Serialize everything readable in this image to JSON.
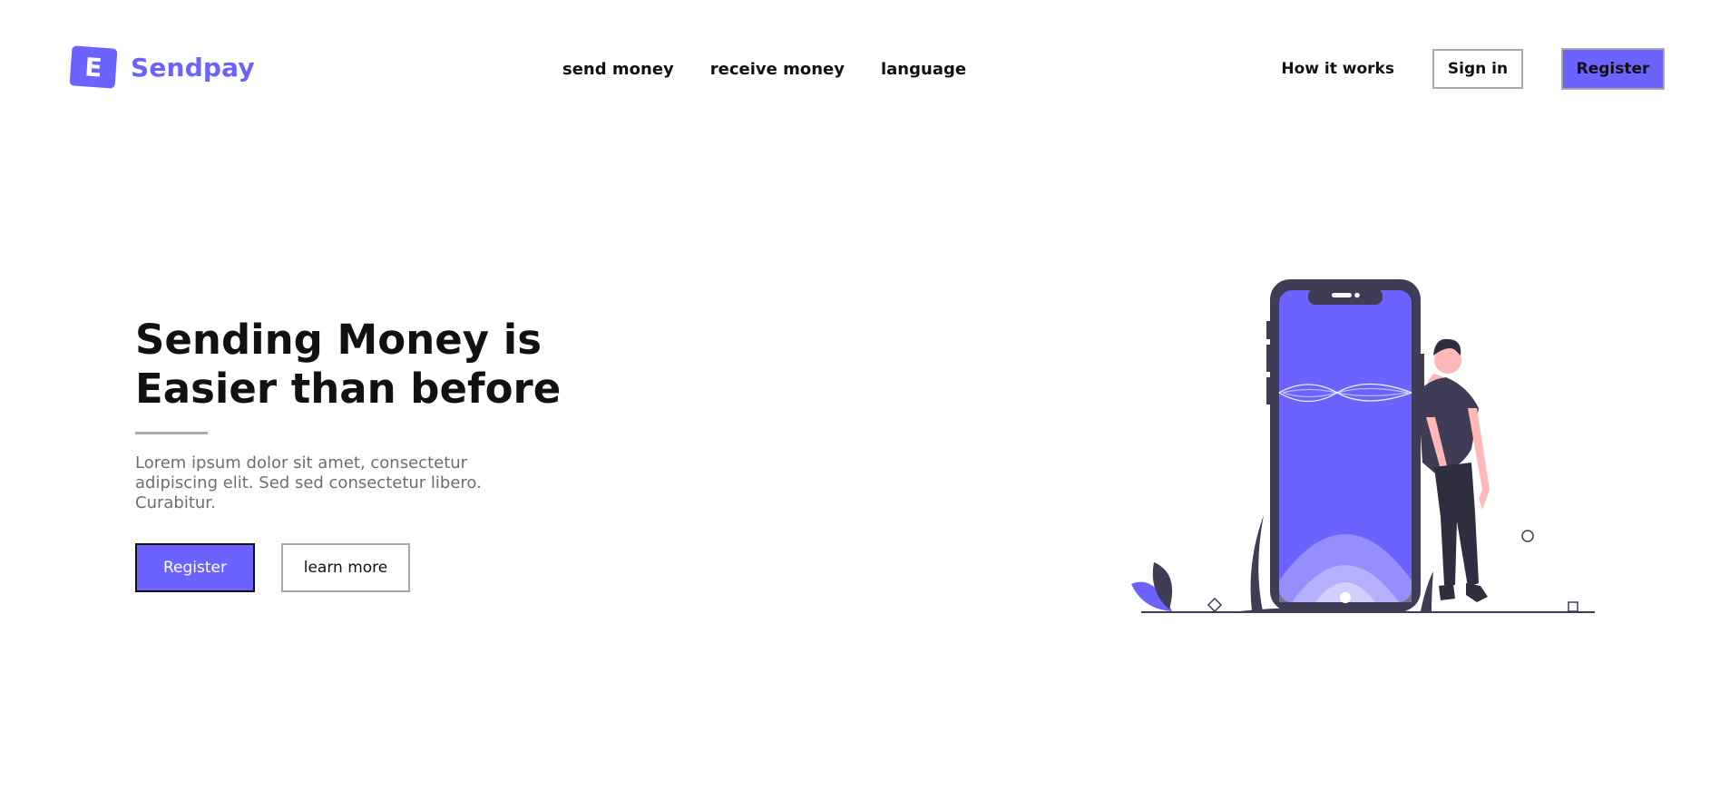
{
  "header": {
    "logo_letter": "E",
    "brand": "Sendpay",
    "nav": [
      {
        "label": "send money"
      },
      {
        "label": "receive money"
      },
      {
        "label": "language"
      }
    ],
    "how_it_works": "How it works",
    "sign_in": "Sign in",
    "register": "Register"
  },
  "hero": {
    "title_line1": "Sending Money is",
    "title_line2": "Easier than before",
    "description": "Lorem ipsum dolor sit amet, consectetur adipiscing elit. Sed sed consectetur libero. Curabitur.",
    "register_button": "Register",
    "learn_more_button": "learn more"
  },
  "colors": {
    "accent": "#6c63ff",
    "dark": "#3f3d56",
    "skin": "#ffb8b8",
    "text": "#111111",
    "muted": "#6e6e6e"
  },
  "illustration": {
    "icon": "phone-person-illustration"
  }
}
